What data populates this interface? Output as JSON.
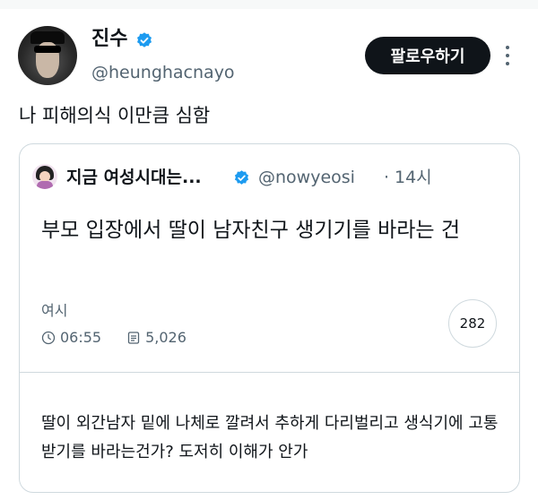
{
  "author": {
    "name": "진수",
    "handle": "@heunghacnayo",
    "follow_label": "팔로우하기"
  },
  "tweet": {
    "text": "나 피해의식 이만큼 심함"
  },
  "quoted": {
    "name": "지금 여성시대는...",
    "handle": "@nowyeosi",
    "dot": "·",
    "time": "14시",
    "title": "부모 입장에서 딸이 남자친구 생기기를 바라는 건",
    "board": "여시",
    "post_time": "06:55",
    "views": "5,026",
    "comment_count": "282",
    "body": "딸이 외간남자 밑에 나체로 깔려서 추하게 다리벌리고 생식기에 고통받기를 바라는건가? 도저히 이해가 안가"
  },
  "colors": {
    "verified": "#1d9bf0",
    "secondary_text": "#536471",
    "follow_bg": "#0f1419"
  },
  "icons": {
    "verified": "verified-badge-icon",
    "more": "more-dots-icon",
    "clock": "clock-icon",
    "views": "document-icon"
  }
}
